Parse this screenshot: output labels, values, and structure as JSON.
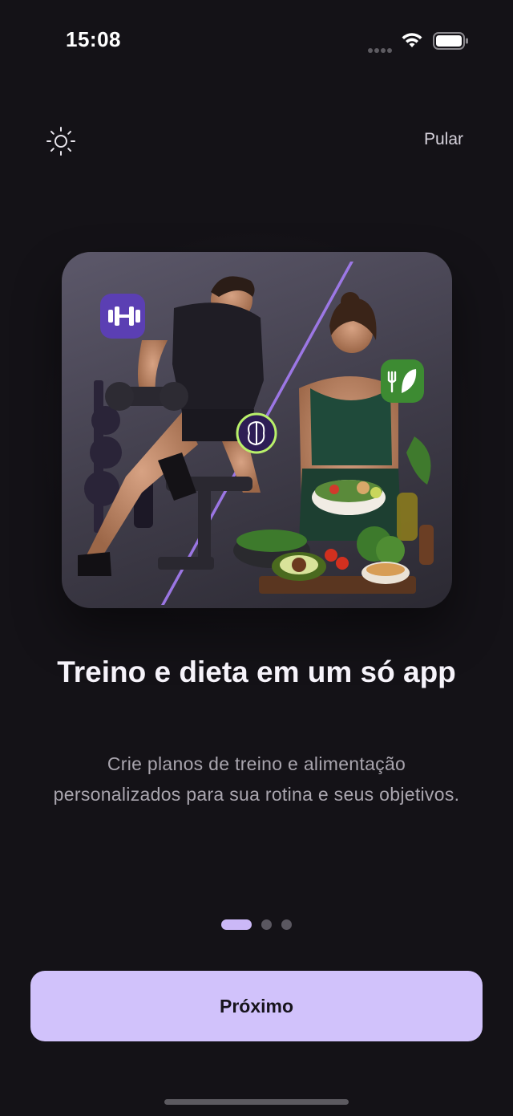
{
  "status_bar": {
    "time": "15:08",
    "icons": [
      "signal-dots-icon",
      "wifi-icon",
      "battery-icon"
    ]
  },
  "header": {
    "theme_icon": "sun-icon",
    "skip_label": "Pular"
  },
  "hero": {
    "badges": [
      "dumbbell-icon",
      "brain-icon",
      "leaf-cutlery-icon"
    ]
  },
  "slide": {
    "title": "Treino e dieta em um só app",
    "description": "Crie planos de treino e alimentação personalizados para sua rotina e seus objetivos."
  },
  "pager": {
    "total": 3,
    "active_index": 0
  },
  "cta": {
    "label": "Próximo"
  },
  "colors": {
    "background": "#141217",
    "accent": "#d1c2fb",
    "accent_dot": "#cbb8f7",
    "text_primary": "#f6f3fa",
    "text_secondary": "#a9a5ae"
  }
}
